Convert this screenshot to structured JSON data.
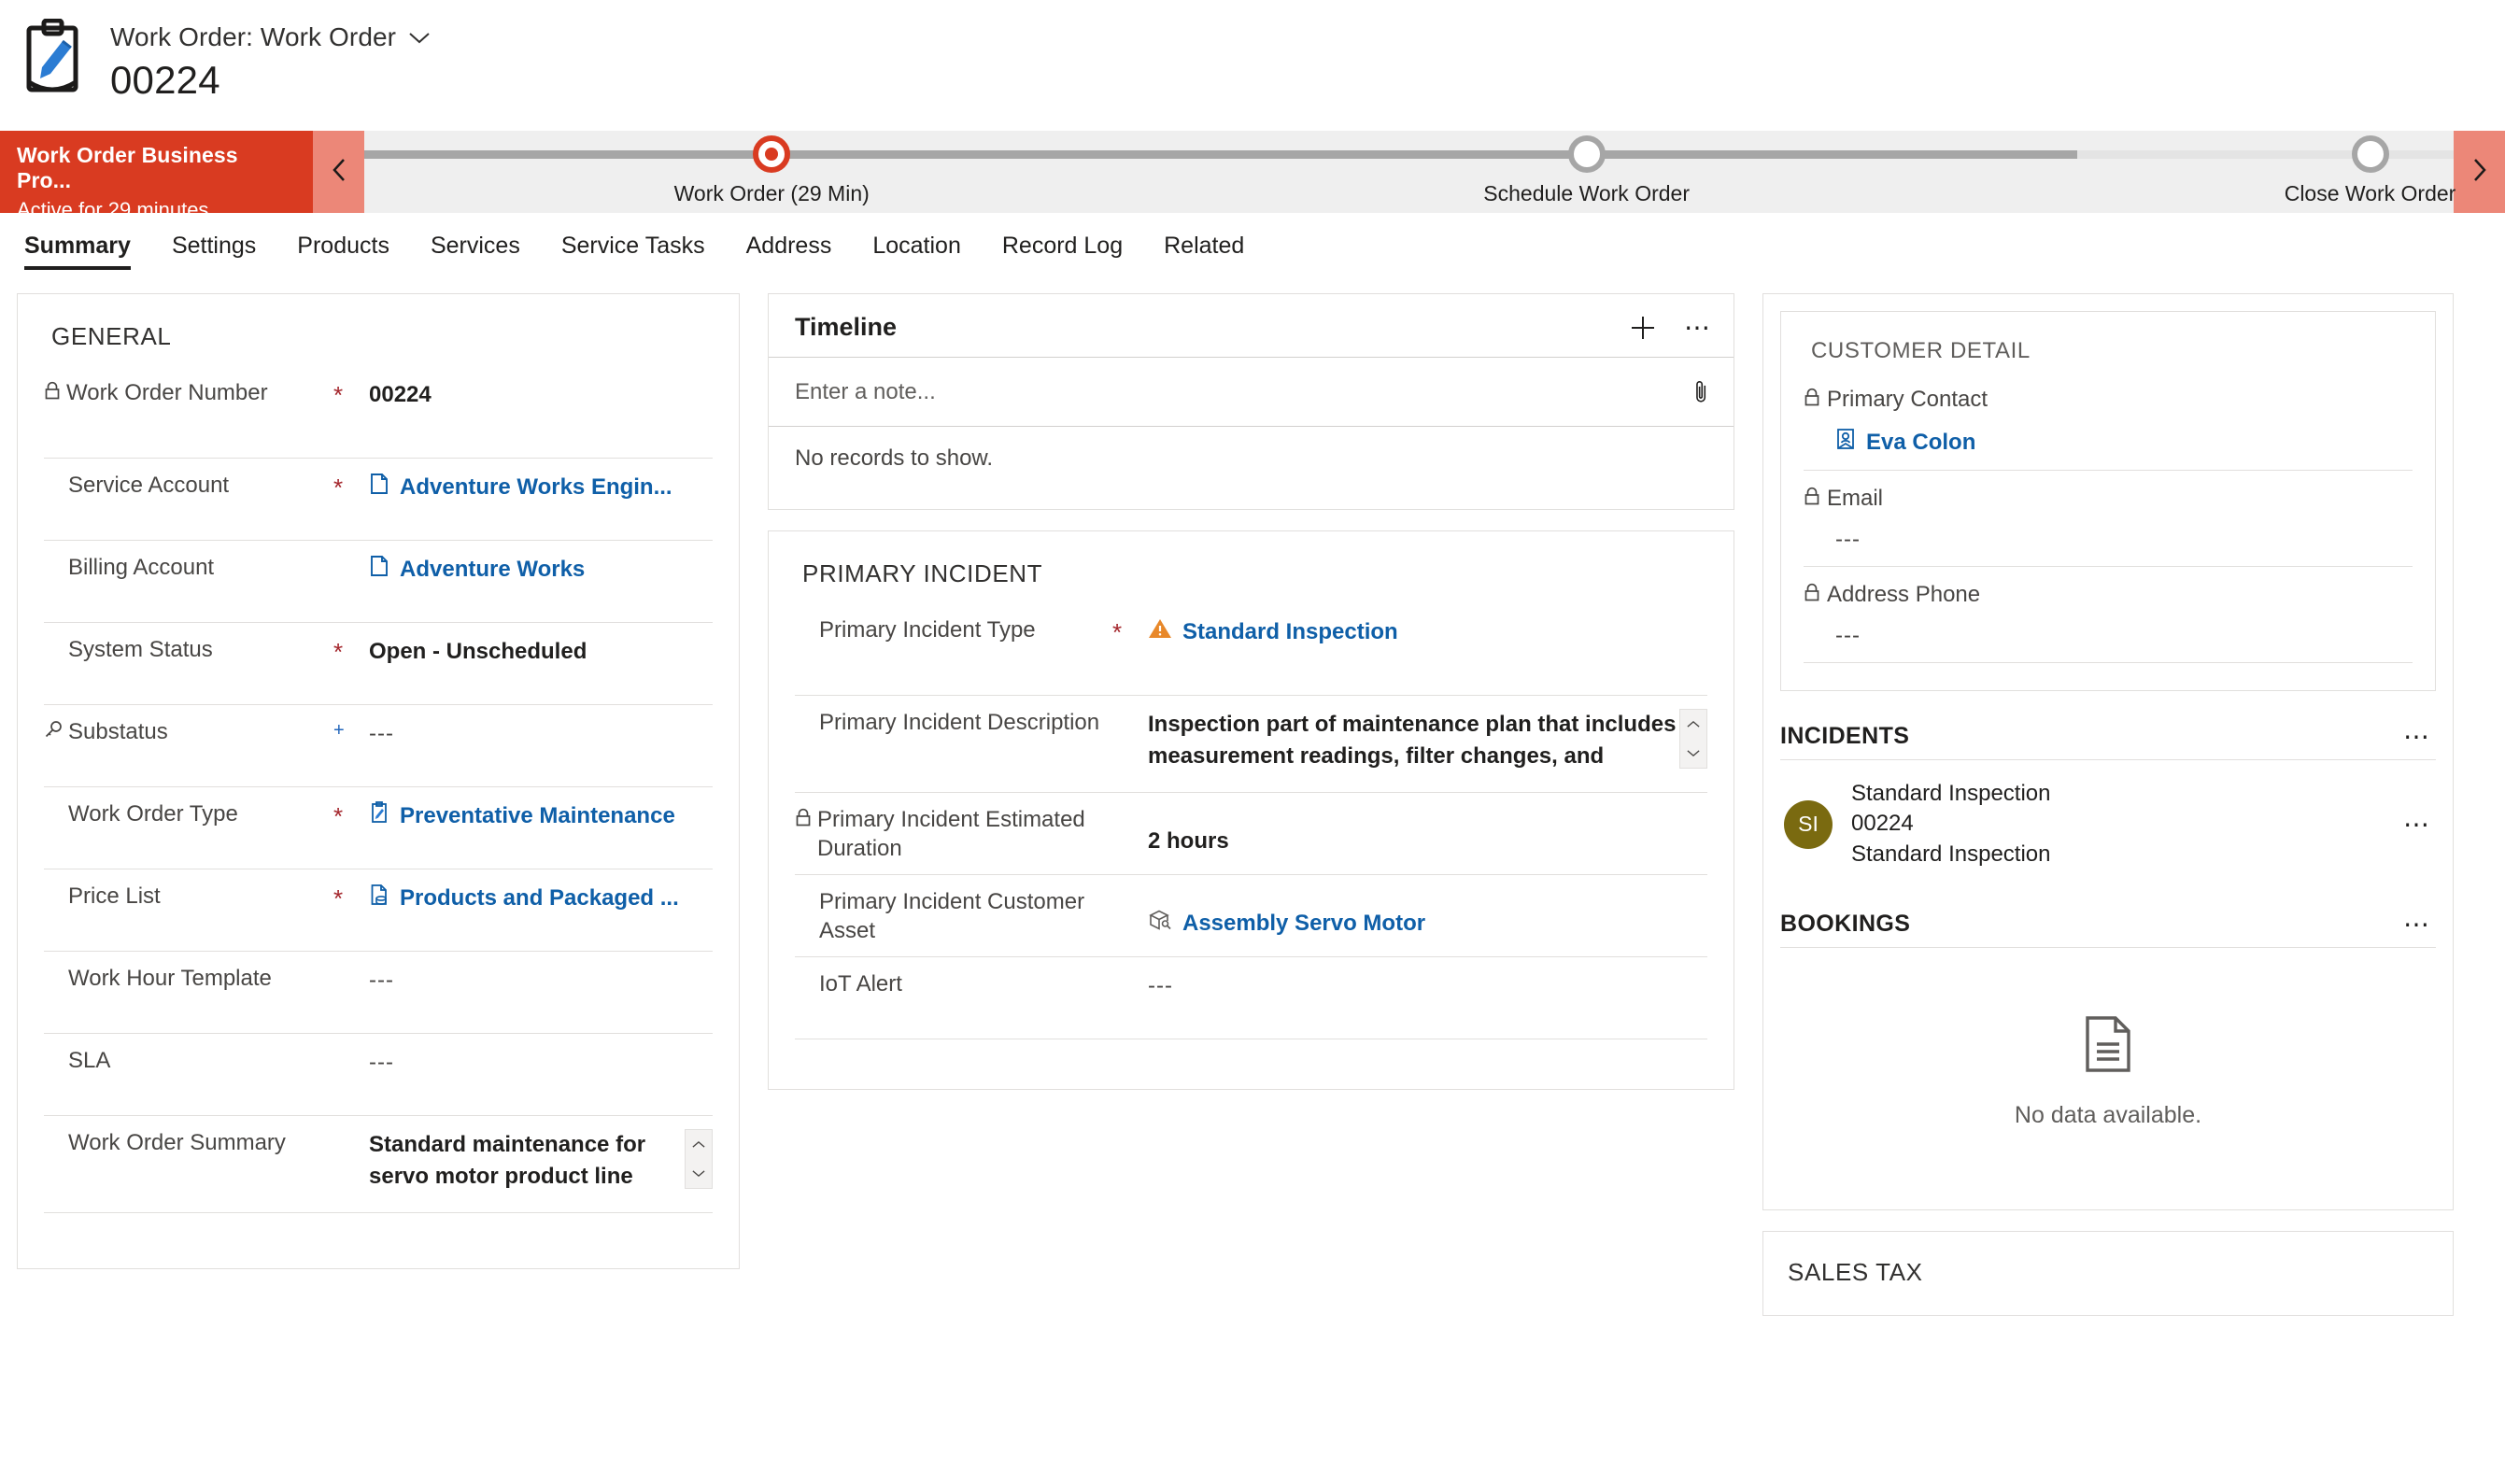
{
  "header": {
    "entity_label": "Work Order: Work Order",
    "record_title": "00224",
    "icon": "clipboard-pen-icon",
    "dropdown_icon": "chevron-down-icon"
  },
  "business_process": {
    "name": "Work Order Business Pro...",
    "status": "Active for 29 minutes",
    "prev_icon": "chevron-left-icon",
    "next_icon": "chevron-right-icon",
    "accent_color": "#d93b21",
    "stages": [
      {
        "label": "Work Order  (29 Min)",
        "state": "active"
      },
      {
        "label": "Schedule Work Order",
        "state": "pending"
      },
      {
        "label": "Close Work Order",
        "state": "pending"
      }
    ]
  },
  "tabs": [
    {
      "label": "Summary",
      "active": true
    },
    {
      "label": "Settings",
      "active": false
    },
    {
      "label": "Products",
      "active": false
    },
    {
      "label": "Services",
      "active": false
    },
    {
      "label": "Service Tasks",
      "active": false
    },
    {
      "label": "Address",
      "active": false
    },
    {
      "label": "Location",
      "active": false
    },
    {
      "label": "Record Log",
      "active": false
    },
    {
      "label": "Related",
      "active": false
    }
  ],
  "general": {
    "title": "GENERAL",
    "fields": [
      {
        "label": "Work Order Number",
        "required": "*",
        "value": "00224",
        "locked": true,
        "kind": "text"
      },
      {
        "label": "Service Account",
        "required": "*",
        "value": "Adventure Works Engin...",
        "kind": "link",
        "icon": "account-icon"
      },
      {
        "label": "Billing Account",
        "required": "",
        "value": "Adventure Works",
        "kind": "link",
        "icon": "account-icon"
      },
      {
        "label": "System Status",
        "required": "*",
        "value": "Open - Unscheduled",
        "kind": "bold"
      },
      {
        "label": "Substatus",
        "required": "+",
        "value": "---",
        "kind": "empty",
        "icon": "lookup-icon"
      },
      {
        "label": "Work Order Type",
        "required": "*",
        "value": "Preventative Maintenance",
        "kind": "link",
        "icon": "workorder-type-icon"
      },
      {
        "label": "Price List",
        "required": "*",
        "value": "Products and Packaged ...",
        "kind": "link",
        "icon": "pricelist-icon"
      },
      {
        "label": "Work Hour Template",
        "required": "",
        "value": "---",
        "kind": "empty"
      },
      {
        "label": "SLA",
        "required": "",
        "value": "---",
        "kind": "empty"
      },
      {
        "label": "Work Order Summary",
        "required": "",
        "value": "Standard maintenance for servo motor product line",
        "kind": "scroll"
      }
    ]
  },
  "timeline": {
    "title": "Timeline",
    "add_icon": "plus-icon",
    "more_icon": "more-icon",
    "note_placeholder": "Enter a note...",
    "attach_icon": "paperclip-icon",
    "empty_text": "No records to show."
  },
  "primary_incident": {
    "title": "PRIMARY INCIDENT",
    "fields": [
      {
        "label": "Primary Incident Type",
        "required": "*",
        "value": "Standard Inspection",
        "kind": "link",
        "icon": "warning-triangle-icon"
      },
      {
        "label": "Primary Incident Description",
        "required": "",
        "value": "Inspection part of maintenance plan that includes measurement readings, filter changes, and",
        "kind": "scroll"
      },
      {
        "label": "Primary Incident Estimated Duration",
        "required": "",
        "value": "2 hours",
        "locked": true,
        "kind": "bold"
      },
      {
        "label": "Primary Incident Customer Asset",
        "required": "",
        "value": "Assembly Servo Motor",
        "kind": "link",
        "icon": "asset-box-icon"
      },
      {
        "label": "IoT Alert",
        "required": "",
        "value": "---",
        "kind": "empty"
      }
    ]
  },
  "customer_detail": {
    "title": "CUSTOMER DETAIL",
    "fields": [
      {
        "label": "Primary Contact",
        "locked": true,
        "value": "Eva Colon",
        "kind": "link",
        "icon": "contact-icon"
      },
      {
        "label": "Email",
        "locked": true,
        "value": "---",
        "kind": "empty"
      },
      {
        "label": "Address Phone",
        "locked": true,
        "value": "---",
        "kind": "empty"
      }
    ]
  },
  "incidents": {
    "title": "INCIDENTS",
    "more_icon": "more-icon",
    "items": [
      {
        "initials": "SI",
        "avatar_color": "#7a6a10",
        "line1": "Standard Inspection",
        "line2": "00224",
        "line3": "Standard Inspection",
        "row_more_icon": "more-icon"
      }
    ]
  },
  "bookings": {
    "title": "BOOKINGS",
    "more_icon": "more-icon",
    "empty_icon": "document-icon",
    "empty_text": "No data available."
  },
  "sales_tax": {
    "title": "SALES TAX"
  }
}
